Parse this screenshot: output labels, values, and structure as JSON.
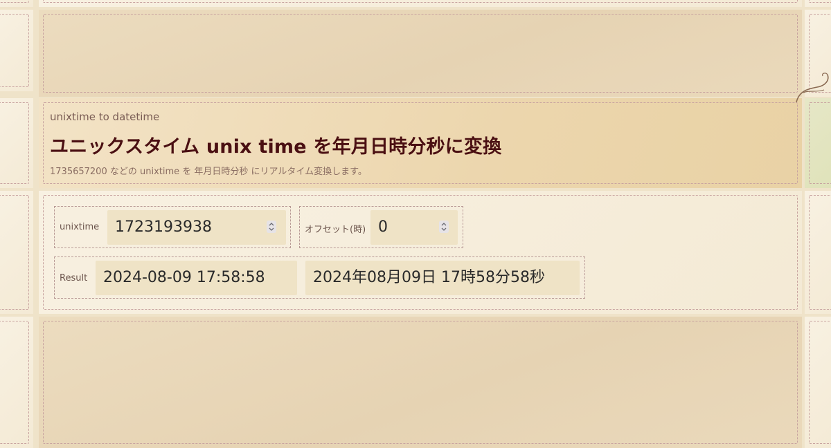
{
  "header": {
    "subtitle": "unixtime to datetime",
    "title": "ユニックスタイム unix time を年月日時分秒に変換",
    "description": "1735657200 などの unixtime を 年月日時分秒 にリアルタイム変換します。"
  },
  "converter": {
    "unixtime": {
      "label": "unixtime",
      "value": "1723193938"
    },
    "offset": {
      "label": "オフセット(時)",
      "value": "0"
    },
    "result": {
      "label": "Result",
      "iso": "2024-08-09 17:58:58",
      "japanese": "2024年08月09日 17時58分58秒"
    }
  },
  "icons": {
    "spinner": "up-down-arrows-icon",
    "decoration": "curl-ornament-icon"
  }
}
